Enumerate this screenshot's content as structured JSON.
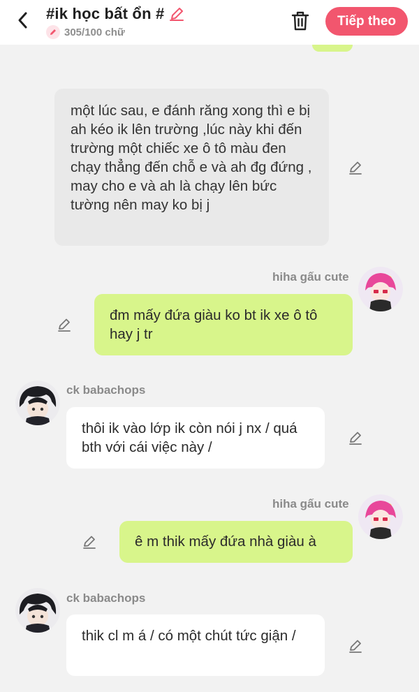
{
  "header": {
    "title": "#ik học bất ổn #",
    "word_count": "305/100 chữ",
    "next_label": "Tiếp theo"
  },
  "messages": [
    {
      "text": "một lúc sau,  e đánh răng xong thì e bị ah  kéo ik lên trường ,lúc này khi đến trường một chiếc xe ô tô màu đen chạy thẳng đến chỗ e và ah đg đứng , may cho e và ah là chạy lên bức tường nên may ko bị j"
    },
    {
      "sender": "hiha gấu cute",
      "text": "đm mấy đứa giàu ko bt ik xe ô tô hay j tr"
    },
    {
      "sender": "ck babachops",
      "text": "thôi ik vào lớp ik còn nói j nx / quá bth với cái việc này /"
    },
    {
      "sender": "hiha gấu cute",
      "text": "ê m thik mấy đứa nhà giàu à"
    },
    {
      "sender": "ck babachops",
      "text": "thik cl m á / có một chút tức giận /"
    }
  ],
  "colors": {
    "accent": "#f2566e",
    "green_bubble": "#d8f58b",
    "gray_bubble": "#e9e9e9",
    "background": "#f2f2f2"
  }
}
